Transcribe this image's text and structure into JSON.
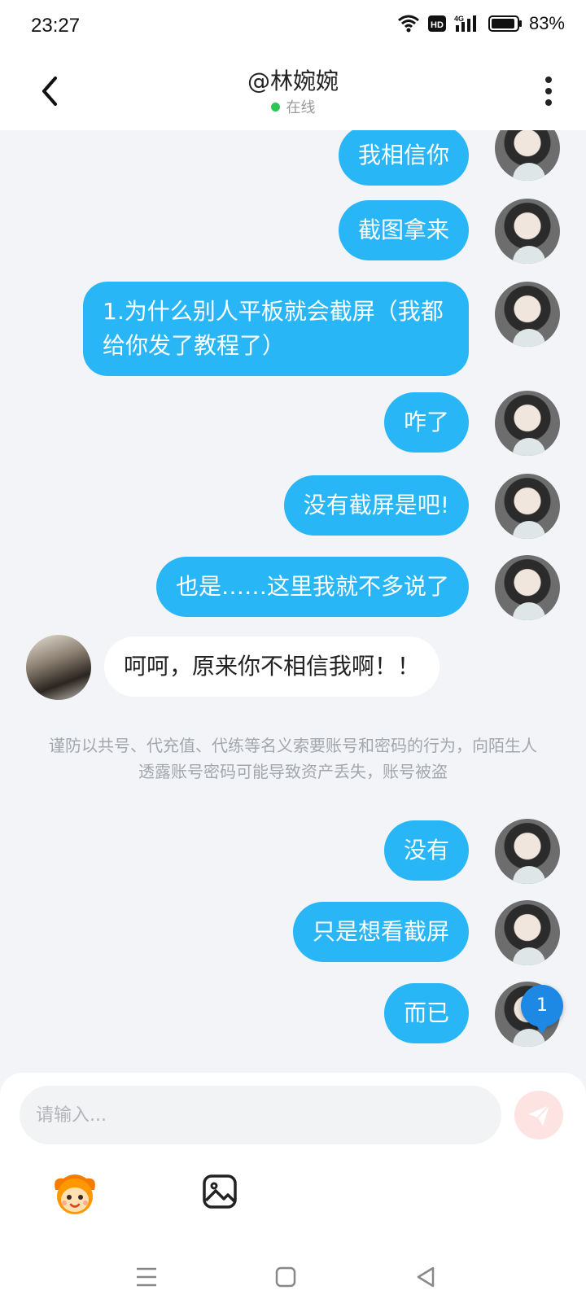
{
  "status_bar": {
    "time": "23:27",
    "battery": "83%",
    "icons": [
      "wifi-icon",
      "hd-icon",
      "signal-4g-icon",
      "battery-icon"
    ]
  },
  "header": {
    "title": "@林婉婉",
    "status": "在线",
    "icons": [
      "back-arrow-icon",
      "more-vertical-icon"
    ]
  },
  "messages": [
    {
      "from": "me",
      "text": "我相信你"
    },
    {
      "from": "me",
      "text": "截图拿来"
    },
    {
      "from": "me",
      "text": "1.为什么别人平板就会截屏（我都给你发了教程了）"
    },
    {
      "from": "me",
      "text": "咋了"
    },
    {
      "from": "me",
      "text": "没有截屏是吧!"
    },
    {
      "from": "me",
      "text": "也是……这里我就不多说了"
    },
    {
      "from": "other",
      "text": "呵呵，原来你不相信我啊！！"
    },
    {
      "from": "me",
      "text": "没有"
    },
    {
      "from": "me",
      "text": "只是想看截屏"
    },
    {
      "from": "me",
      "text": "而已"
    }
  ],
  "notice": "谨防以共号、代充值、代练等名义索要账号和密码的行为，向陌生人透露账号密码可能导致资产丢失，账号被盗",
  "unread_badge": "1",
  "input": {
    "placeholder": "请输入...",
    "value": ""
  },
  "toolbar_icons": [
    "send-icon",
    "emoji-icon",
    "image-icon"
  ],
  "nav_icons": [
    "menu-icon",
    "home-icon",
    "back-triangle-icon"
  ],
  "colors": {
    "outgoing_bubble": "#29b6f6",
    "incoming_bubble": "#ffffff",
    "background": "#f2f4f7",
    "online": "#2dc653",
    "badge": "#1e88e5",
    "send_button": "#fde4e2"
  }
}
